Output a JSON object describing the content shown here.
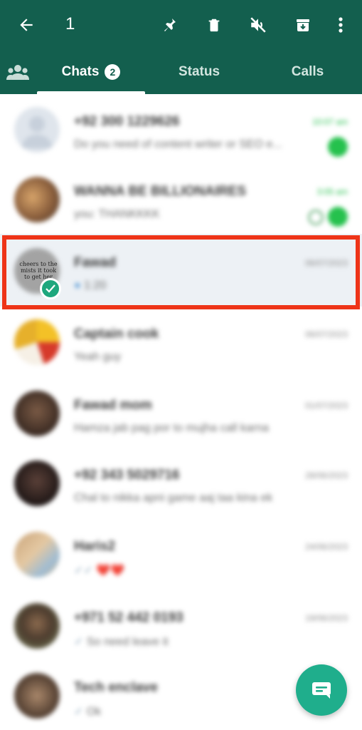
{
  "header": {
    "selection_count": "1",
    "icons": [
      "back-arrow-icon",
      "pin-icon",
      "delete-icon",
      "mute-icon",
      "archive-icon",
      "more-vert-icon"
    ]
  },
  "tabs": {
    "chats_label": "Chats",
    "chats_badge": "2",
    "status_label": "Status",
    "calls_label": "Calls"
  },
  "chats": [
    {
      "name": "+92 300 1229626",
      "message": "Do you need of content writer or SEO e...",
      "time": "10:07 am",
      "unread": true,
      "time_green": true
    },
    {
      "name": "WANNA BE BILLIONAIRES",
      "message": "you: THANKKKK",
      "time": "3:05 am",
      "unread": true,
      "time_green": true
    },
    {
      "name": "Fawad",
      "message": "1:20",
      "time": "06/07/2023",
      "unread": false,
      "selected": true
    },
    {
      "name": "Captain cook",
      "message": "Yeah guy",
      "time": "06/07/2023",
      "unread": false
    },
    {
      "name": "Fawad mom",
      "message": "Hamza jab pag por to mujha call karna",
      "time": "01/07/2023",
      "unread": false
    },
    {
      "name": "+92 343 5029716",
      "message": "Chal to nikka apni game aaj taa kina ek",
      "time": "28/06/2023",
      "unread": false
    },
    {
      "name": "Haris2",
      "message": "❤️❤️",
      "time": "24/06/2023",
      "unread": false
    },
    {
      "name": "+971 52 442 0193",
      "message": "So need leave it",
      "time": "19/06/2023",
      "unread": false
    },
    {
      "name": "Tech enclave",
      "message": "Ok",
      "time": "15",
      "unread": false
    }
  ],
  "selected_avatar_text": "cheers to the mists it took to get her",
  "fab_icon": "new-chat-icon",
  "colors": {
    "header": "#135f4e",
    "accent": "#1fae8c",
    "unread": "#25c14d",
    "highlight": "#ee3418"
  }
}
